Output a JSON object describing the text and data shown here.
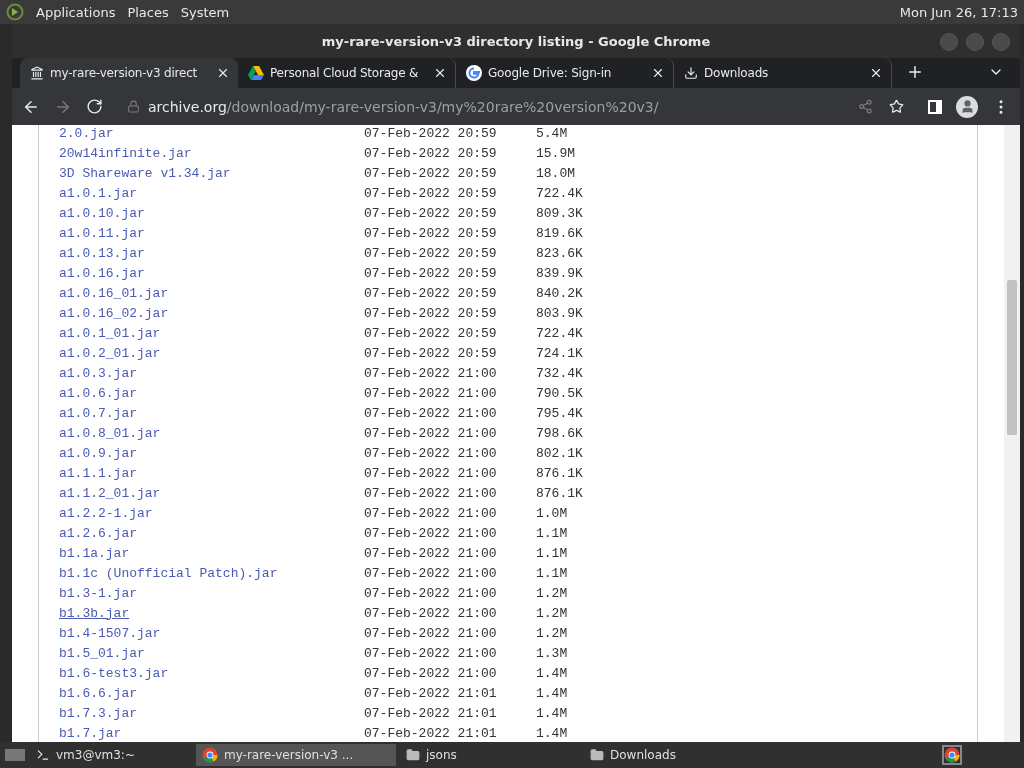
{
  "top_panel": {
    "menus": [
      "Applications",
      "Places",
      "System"
    ],
    "clock": "Mon Jun 26, 17:13"
  },
  "window": {
    "title": "my-rare-version-v3 directory listing - Google Chrome"
  },
  "tabs": [
    {
      "kind": "archive",
      "label": "my-rare-version-v3 direct",
      "selected": true
    },
    {
      "kind": "drive",
      "label": "Personal Cloud Storage &",
      "selected": false
    },
    {
      "kind": "google",
      "label": "Google Drive: Sign-in",
      "selected": false
    },
    {
      "kind": "download",
      "label": "Downloads",
      "selected": false
    }
  ],
  "address": {
    "host": "archive.org",
    "path": "/download/my-rare-version-v3/my%20rare%20version%20v3/"
  },
  "files": [
    {
      "name": "2.0.jar",
      "date": "07-Feb-2022 20:59",
      "size": "5.4M",
      "hovered": false
    },
    {
      "name": "20w14infinite.jar",
      "date": "07-Feb-2022 20:59",
      "size": "15.9M",
      "hovered": false
    },
    {
      "name": "3D Shareware v1.34.jar",
      "date": "07-Feb-2022 20:59",
      "size": "18.0M",
      "hovered": false
    },
    {
      "name": "a1.0.1.jar",
      "date": "07-Feb-2022 20:59",
      "size": "722.4K",
      "hovered": false
    },
    {
      "name": "a1.0.10.jar",
      "date": "07-Feb-2022 20:59",
      "size": "809.3K",
      "hovered": false
    },
    {
      "name": "a1.0.11.jar",
      "date": "07-Feb-2022 20:59",
      "size": "819.6K",
      "hovered": false
    },
    {
      "name": "a1.0.13.jar",
      "date": "07-Feb-2022 20:59",
      "size": "823.6K",
      "hovered": false
    },
    {
      "name": "a1.0.16.jar",
      "date": "07-Feb-2022 20:59",
      "size": "839.9K",
      "hovered": false
    },
    {
      "name": "a1.0.16_01.jar",
      "date": "07-Feb-2022 20:59",
      "size": "840.2K",
      "hovered": false
    },
    {
      "name": "a1.0.16_02.jar",
      "date": "07-Feb-2022 20:59",
      "size": "803.9K",
      "hovered": false
    },
    {
      "name": "a1.0.1_01.jar",
      "date": "07-Feb-2022 20:59",
      "size": "722.4K",
      "hovered": false
    },
    {
      "name": "a1.0.2_01.jar",
      "date": "07-Feb-2022 20:59",
      "size": "724.1K",
      "hovered": false
    },
    {
      "name": "a1.0.3.jar",
      "date": "07-Feb-2022 21:00",
      "size": "732.4K",
      "hovered": false
    },
    {
      "name": "a1.0.6.jar",
      "date": "07-Feb-2022 21:00",
      "size": "790.5K",
      "hovered": false
    },
    {
      "name": "a1.0.7.jar",
      "date": "07-Feb-2022 21:00",
      "size": "795.4K",
      "hovered": false
    },
    {
      "name": "a1.0.8_01.jar",
      "date": "07-Feb-2022 21:00",
      "size": "798.6K",
      "hovered": false
    },
    {
      "name": "a1.0.9.jar",
      "date": "07-Feb-2022 21:00",
      "size": "802.1K",
      "hovered": false
    },
    {
      "name": "a1.1.1.jar",
      "date": "07-Feb-2022 21:00",
      "size": "876.1K",
      "hovered": false
    },
    {
      "name": "a1.1.2_01.jar",
      "date": "07-Feb-2022 21:00",
      "size": "876.1K",
      "hovered": false
    },
    {
      "name": "a1.2.2-1.jar",
      "date": "07-Feb-2022 21:00",
      "size": "1.0M",
      "hovered": false
    },
    {
      "name": "a1.2.6.jar",
      "date": "07-Feb-2022 21:00",
      "size": "1.1M",
      "hovered": false
    },
    {
      "name": "b1.1a.jar",
      "date": "07-Feb-2022 21:00",
      "size": "1.1M",
      "hovered": false
    },
    {
      "name": "b1.1c (Unofficial Patch).jar",
      "date": "07-Feb-2022 21:00",
      "size": "1.1M",
      "hovered": false
    },
    {
      "name": "b1.3-1.jar",
      "date": "07-Feb-2022 21:00",
      "size": "1.2M",
      "hovered": false
    },
    {
      "name": "b1.3b.jar",
      "date": "07-Feb-2022 21:00",
      "size": "1.2M",
      "hovered": true
    },
    {
      "name": "b1.4-1507.jar",
      "date": "07-Feb-2022 21:00",
      "size": "1.2M",
      "hovered": false
    },
    {
      "name": "b1.5_01.jar",
      "date": "07-Feb-2022 21:00",
      "size": "1.3M",
      "hovered": false
    },
    {
      "name": "b1.6-test3.jar",
      "date": "07-Feb-2022 21:00",
      "size": "1.4M",
      "hovered": false
    },
    {
      "name": "b1.6.6.jar",
      "date": "07-Feb-2022 21:01",
      "size": "1.4M",
      "hovered": false
    },
    {
      "name": "b1.7.3.jar",
      "date": "07-Feb-2022 21:01",
      "size": "1.4M",
      "hovered": false
    },
    {
      "name": "b1.7.jar",
      "date": "07-Feb-2022 21:01",
      "size": "1.4M",
      "hovered": false
    }
  ],
  "taskbar": [
    {
      "kind": "terminal",
      "label": "vm3@vm3:~",
      "selected": false
    },
    {
      "kind": "chrome",
      "label": "my-rare-version-v3 ...",
      "selected": true
    },
    {
      "kind": "folder",
      "label": "jsons",
      "selected": false
    },
    {
      "kind": "folder",
      "label": "Downloads",
      "selected": false
    }
  ]
}
